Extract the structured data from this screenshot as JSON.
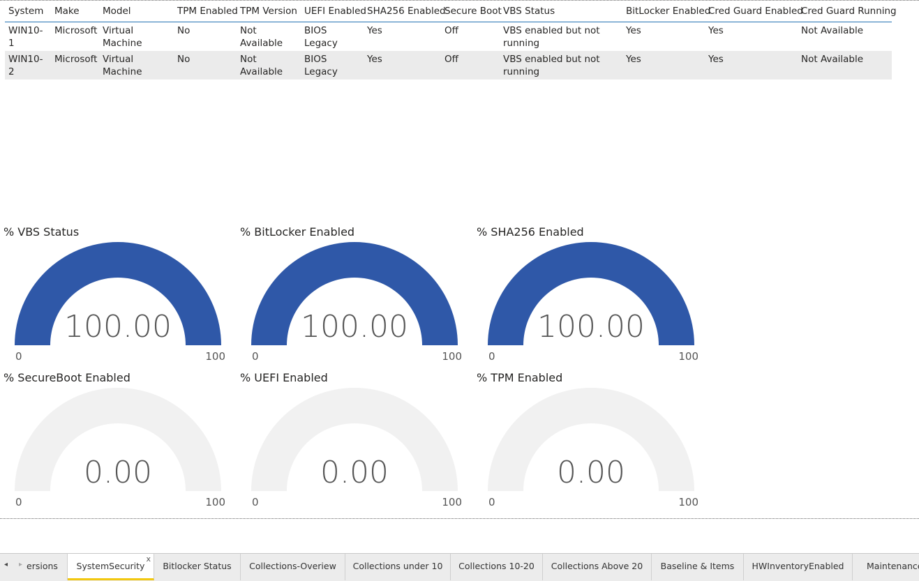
{
  "table": {
    "columns": [
      "System",
      "Make",
      "Model",
      "TPM Enabled",
      "TPM Version",
      "UEFI Enabled",
      "SHA256 Enabled",
      "Secure Boot",
      "VBS Status",
      "BitLocker Enabled",
      "Cred Guard Enabled",
      "Cred Guard Running"
    ],
    "rows": [
      [
        "WIN10-1",
        "Microsoft",
        "Virtual Machine",
        "No",
        "Not Available",
        "BIOS Legacy",
        "Yes",
        "Off",
        "VBS enabled but not running",
        "Yes",
        "Yes",
        "Not Available"
      ],
      [
        "WIN10-2",
        "Microsoft",
        "Virtual Machine",
        "No",
        "Not Available",
        "BIOS Legacy",
        "Yes",
        "Off",
        "VBS enabled but not running",
        "Yes",
        "Yes",
        "Not Available"
      ]
    ]
  },
  "gauges": [
    {
      "title": "% VBS Status",
      "value": "100.00",
      "fraction": 1.0,
      "min": "0",
      "max": "100",
      "color": "#2f58a8"
    },
    {
      "title": "% BitLocker Enabled",
      "value": "100.00",
      "fraction": 1.0,
      "min": "0",
      "max": "100",
      "color": "#2f58a8"
    },
    {
      "title": "% SHA256 Enabled",
      "value": "100.00",
      "fraction": 1.0,
      "min": "0",
      "max": "100",
      "color": "#2f58a8"
    },
    {
      "title": "% SecureBoot Enabled",
      "value": "0.00",
      "fraction": 0.0,
      "min": "0",
      "max": "100",
      "color": "#2f58a8"
    },
    {
      "title": "% UEFI Enabled",
      "value": "0.00",
      "fraction": 0.0,
      "min": "0",
      "max": "100",
      "color": "#2f58a8"
    },
    {
      "title": "% TPM Enabled",
      "value": "0.00",
      "fraction": 0.0,
      "min": "0",
      "max": "100",
      "color": "#2f58a8"
    }
  ],
  "gauge_track_color": "#f1f1f1",
  "tabs": {
    "nav_prev": "◂",
    "nav_next": "▸",
    "items": [
      {
        "label": "ersions"
      },
      {
        "label": "SystemSecurity",
        "active": true,
        "close": "x"
      },
      {
        "label": "Bitlocker Status"
      },
      {
        "label": "Collections-Overiew"
      },
      {
        "label": "Collections under 10"
      },
      {
        "label": "Collections 10-20"
      },
      {
        "label": "Collections Above 20"
      },
      {
        "label": "Baseline & Items"
      },
      {
        "label": "HWInventoryEnabled"
      },
      {
        "label": "MaintenanceT"
      }
    ]
  }
}
